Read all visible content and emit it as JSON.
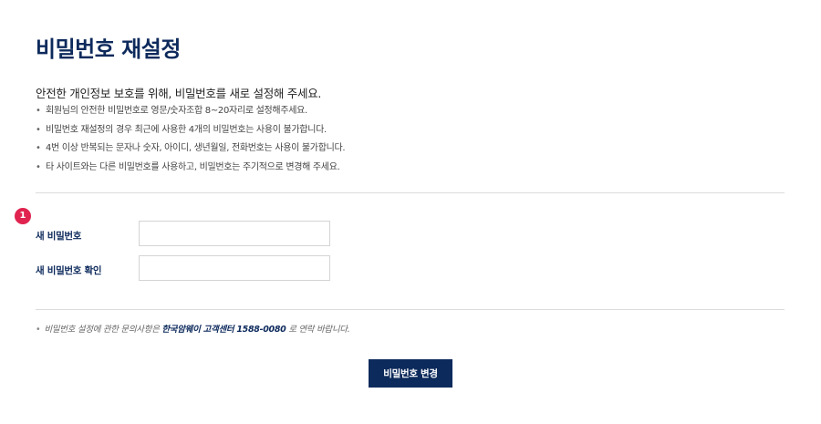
{
  "page": {
    "title": "비밀번호 재설정",
    "intro": "안전한 개인정보 보호를 위해, 비밀번호를 새로 설정해 주세요.",
    "bullet": "•",
    "rules": [
      "회원님의 안전한 비밀번호로 영문/숫자조합 8~20자리로 설정해주세요.",
      "비밀번호 재설정의 경우 최근에 사용한 4개의 비밀번호는 사용이 불가합니다.",
      "4번 이상 반복되는 문자나 숫자, 아이디, 생년월일, 전화번호는 사용이 불가합니다.",
      "타 사이트와는 다른 비밀번호를 사용하고, 비밀번호는 주기적으로 변경해 주세요."
    ]
  },
  "form": {
    "step": "1",
    "new_password_label": "새 비밀번호",
    "new_password_value": "",
    "confirm_password_label": "새 비밀번호 확인",
    "confirm_password_value": ""
  },
  "footnote": {
    "bullet": "•",
    "prefix": "비밀번호 설정에 관한 문의사항은 ",
    "contact": "한국암웨이 고객센터 1588-0080",
    "suffix": " 로 연락 바랍니다."
  },
  "actions": {
    "submit_label": "비밀번호 변경"
  },
  "colors": {
    "brand_navy": "#0d2a5c",
    "step_badge": "#e0234f",
    "divider": "#dcdcdc"
  }
}
